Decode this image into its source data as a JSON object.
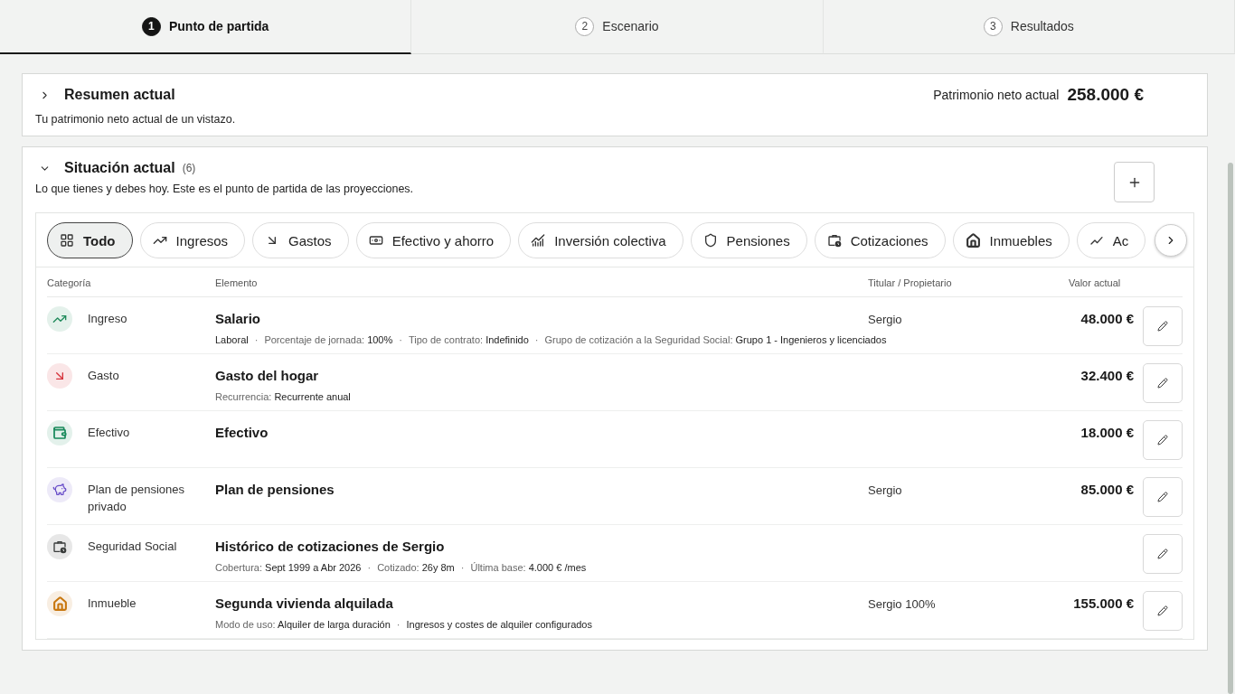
{
  "steps": [
    {
      "number": "1",
      "label": "Punto de partida",
      "selected": true
    },
    {
      "number": "2",
      "label": "Escenario",
      "selected": false
    },
    {
      "number": "3",
      "label": "Resultados",
      "selected": false
    }
  ],
  "summary": {
    "title": "Resumen actual",
    "expanded": false,
    "subtitle": "Tu patrimonio neto actual de un vistazo.",
    "net_worth_label": "Patrimonio neto actual",
    "net_worth": "258.000 €"
  },
  "situation": {
    "title": "Situación actual",
    "count": "(6)",
    "expanded": true,
    "subtitle": "Lo que tienes y debes hoy. Este es el punto de partida de las proyecciones.",
    "filters": [
      {
        "kind": "all",
        "label": "Todo",
        "selected": true
      },
      {
        "kind": "income",
        "label": "Ingresos",
        "selected": false
      },
      {
        "kind": "expense",
        "label": "Gastos",
        "selected": false
      },
      {
        "kind": "cash",
        "label": "Efectivo y ahorro",
        "selected": false
      },
      {
        "kind": "fund",
        "label": "Inversión colectiva",
        "selected": false
      },
      {
        "kind": "pension",
        "label": "Pensiones",
        "selected": false
      },
      {
        "kind": "contributions",
        "label": "Cotizaciones",
        "selected": false
      },
      {
        "kind": "property",
        "label": "Inmuebles",
        "selected": false
      },
      {
        "kind": "stocks",
        "label": "Ac",
        "selected": false
      }
    ],
    "table": {
      "columns": [
        "Categoría",
        "Elemento",
        "Titular / Propietario",
        "Valor actual"
      ],
      "rows": [
        {
          "kind": "income",
          "color": "#1f8a5b",
          "category": "Ingreso",
          "title": "Salario",
          "owner": "Sergio",
          "value": "48.000 €",
          "meta": [
            {
              "value": "Laboral"
            },
            {
              "separator": "·",
              "label": "Porcentaje de jornada:",
              "value": "100%"
            },
            {
              "separator": "·",
              "label": "Tipo de contrato:",
              "value": "Indefinido"
            },
            {
              "separator": "·",
              "label": "Grupo de cotización a la Seguridad Social:",
              "value": "Grupo 1 - Ingenieros y licenciados"
            }
          ]
        },
        {
          "kind": "expense",
          "color": "#d6343c",
          "category": "Gasto",
          "title": "Gasto del hogar",
          "value": "32.400 €",
          "meta": [
            {
              "label": "Recurrencia:",
              "value": "Recurrente anual"
            }
          ]
        },
        {
          "kind": "cash",
          "color": "#17895a",
          "category": "Efectivo",
          "title": "Efectivo",
          "value": "18.000 €"
        },
        {
          "kind": "pension",
          "color": "#6a4fc9",
          "category": "Plan de pensiones privado",
          "title": "Plan de pensiones",
          "owner": "Sergio",
          "value": "85.000 €"
        },
        {
          "kind": "contributions",
          "color": "#3a3d3c",
          "category": "Seguridad Social",
          "title": "Histórico de cotizaciones de Sergio",
          "meta": [
            {
              "label": "Cobertura:",
              "value": "Sept 1999 a Abr 2026"
            },
            {
              "separator": "·",
              "label": "Cotizado:",
              "value": "26y 8m"
            },
            {
              "separator": "·",
              "label": "Última base:",
              "value": "4.000 € /mes"
            }
          ]
        },
        {
          "kind": "property",
          "color": "#c8770f",
          "category": "Inmueble",
          "title": "Segunda vivienda alquilada",
          "owner": "Sergio 100%",
          "value": "155.000 €",
          "meta": [
            {
              "label": "Modo de uso:",
              "value": "Alquiler de larga duración"
            },
            {
              "separator": "·",
              "value": "Ingresos y costes de alquiler configurados"
            }
          ]
        }
      ]
    }
  }
}
